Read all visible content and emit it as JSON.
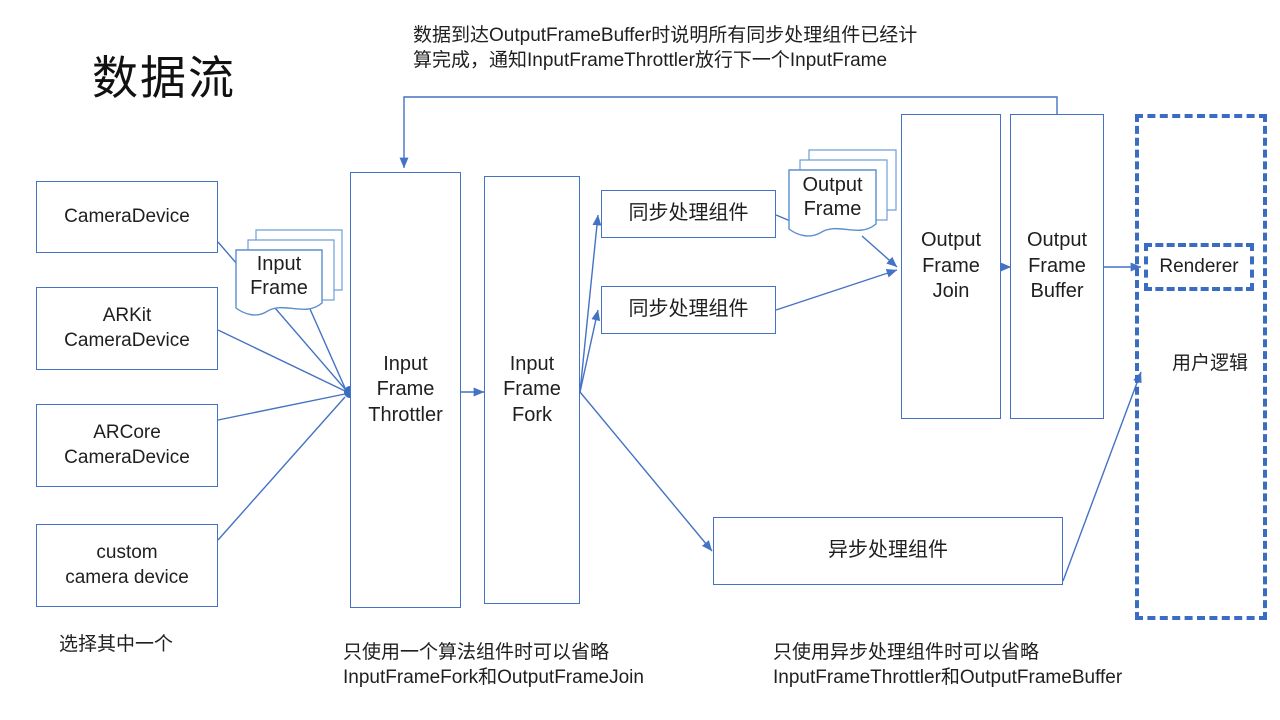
{
  "title": "数据流",
  "colors": {
    "stroke": "#4472c4",
    "dashed": "#3b6cc4",
    "text": "#1f1f1f",
    "background": "#ffffff"
  },
  "top_note": "数据到达OutputFrameBuffer时说明所有同步处理组件已经计\n算完成，通知InputFrameThrottler放行下一个InputFrame",
  "sources": [
    {
      "id": "camera-device",
      "label": "CameraDevice"
    },
    {
      "id": "arkit-camera-device",
      "label": "ARKit\nCameraDevice"
    },
    {
      "id": "arcore-camera-device",
      "label": "ARCore\nCameraDevice"
    },
    {
      "id": "custom-camera-device",
      "label": "custom\ncamera device"
    }
  ],
  "artifacts": {
    "input_frame": "Input\nFrame",
    "output_frame": "Output\nFrame"
  },
  "pipeline": {
    "input_frame_throttler": "Input\nFrame\nThrottler",
    "input_frame_fork": "Input\nFrame\nFork",
    "output_frame_join": "Output\nFrame\nJoin",
    "output_frame_buffer": "Output\nFrame\nBuffer"
  },
  "processors": {
    "sync_1": "同步处理组件",
    "sync_2": "同步处理组件",
    "async": "异步处理组件"
  },
  "user_logic": {
    "container_label": "用户逻辑",
    "renderer_label": "Renderer"
  },
  "captions": {
    "sources": "选择其中一个",
    "fork_note": "只使用一个算法组件时可以省略\nInputFrameFork和OutputFrameJoin",
    "async_note": "只使用异步处理组件时可以省略\nInputFrameThrottler和OutputFrameBuffer"
  }
}
